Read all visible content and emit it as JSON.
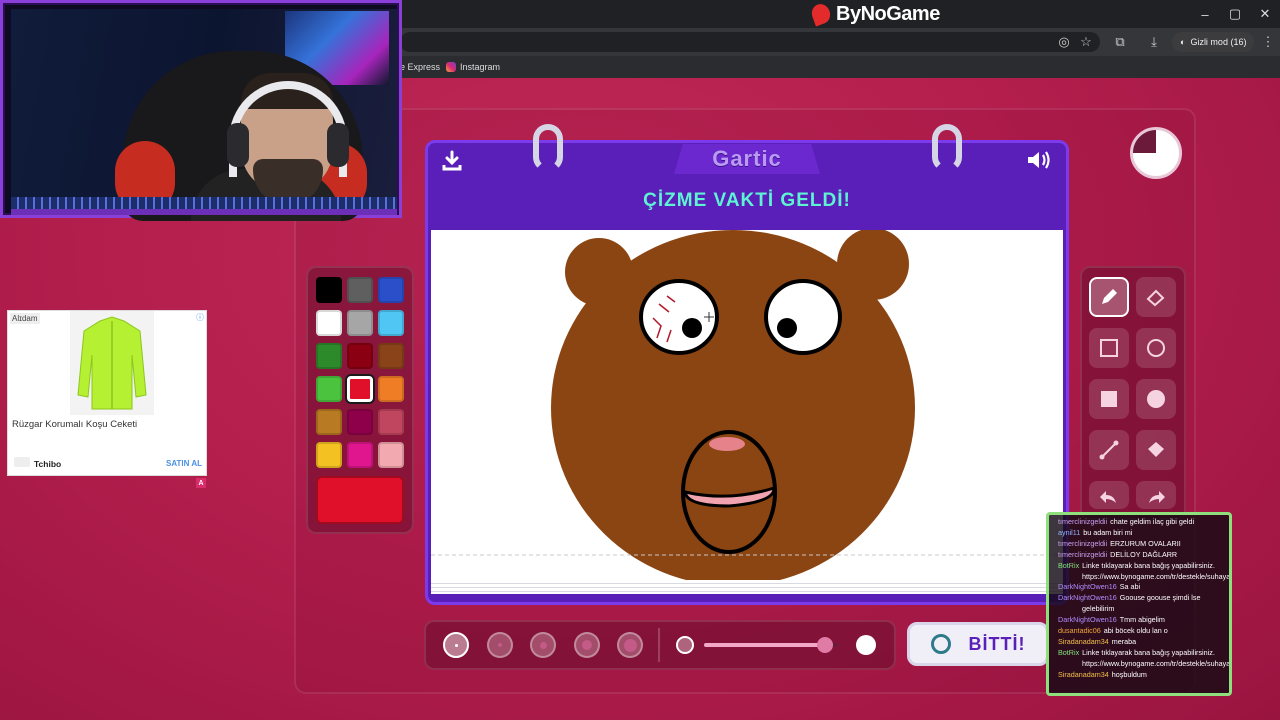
{
  "browser": {
    "brand": "ByNoGame",
    "profile": "Gizli mod (16)",
    "bookmarks": [
      "e Express",
      "Instagram"
    ]
  },
  "ad": {
    "tag": "Alɪdam",
    "title": "Rüzgar Korumalı Koşu Ceketi",
    "brand": "Tchibo",
    "cta": "SATIN AL",
    "badge": "A"
  },
  "game": {
    "logo": "Gartic",
    "headline": "ÇİZME VAKTİ GELDİ!",
    "done_label": "BİTTİ!",
    "timer_remaining_fraction": 0.75,
    "opacity_fraction": 0.9,
    "selected_color": "#e0102a",
    "selected_tool": "pencil-icon",
    "palette": [
      [
        "#000000",
        "#5f5f5f",
        "#2b4fc9"
      ],
      [
        "#ffffff",
        "#a6a6a6",
        "#4fc6f3"
      ],
      [
        "#2d8a2a",
        "#8a0012",
        "#8a4318"
      ],
      [
        "#4cc33f",
        "#e0102a",
        "#ef7d26"
      ],
      [
        "#b87a22",
        "#8e0049",
        "#c0455f"
      ],
      [
        "#f4c122",
        "#e0168f",
        "#f3a9b0"
      ]
    ],
    "tools": [
      "pencil-icon",
      "eraser-icon",
      "rectangle-icon",
      "circle-icon",
      "filled-rectangle-icon",
      "filled-circle-icon",
      "line-icon",
      "fill-bucket-icon",
      "undo-icon",
      "redo-icon"
    ]
  },
  "chat": [
    {
      "user": "tımerclinizgeldii",
      "color": "#c9a0f0",
      "text": "chate geldim ilaç gibi geldi"
    },
    {
      "user": "aynil11",
      "color": "#8fb4ff",
      "text": "bu adam biri mi"
    },
    {
      "user": "tımerclinizgeldii",
      "color": "#c9a0f0",
      "text": "ERZURUM OVALARII"
    },
    {
      "user": "tımerclinizgeldii",
      "color": "#c9a0f0",
      "text": "DELİLOY DAĞLARR"
    },
    {
      "user": "BotRix",
      "color": "#7fe27a",
      "text": "Linke tıklayarak bana bağış yapabilirsiniz."
    },
    {
      "user": "",
      "color": "#ffffff",
      "text": "https://www.bynogame.com/tr/destekle/suhayar"
    },
    {
      "user": "DarkNightOwen16",
      "color": "#b28cff",
      "text": "Sa abi"
    },
    {
      "user": "DarkNightOwen16",
      "color": "#b28cff",
      "text": "Goouse goouse şimdi lse"
    },
    {
      "user": "",
      "color": "#ffffff",
      "text": "gelebilirim"
    },
    {
      "user": "DarkNightOwen16",
      "color": "#b28cff",
      "text": "Tmm abigelim"
    },
    {
      "user": "dusantadic06",
      "color": "#f2a83b",
      "text": "abi böcek oldu lan o"
    },
    {
      "user": "Siradanadam34",
      "color": "#f2c04a",
      "text": "meraba"
    },
    {
      "user": "BotRix",
      "color": "#7fe27a",
      "text": "Linke tıklayarak bana bağış yapabilirsiniz."
    },
    {
      "user": "",
      "color": "#ffffff",
      "text": "https://www.bynogame.com/tr/destekle/suhayar"
    },
    {
      "user": "Siradanadam34",
      "color": "#f2c04a",
      "text": "hoşbuldum"
    }
  ]
}
